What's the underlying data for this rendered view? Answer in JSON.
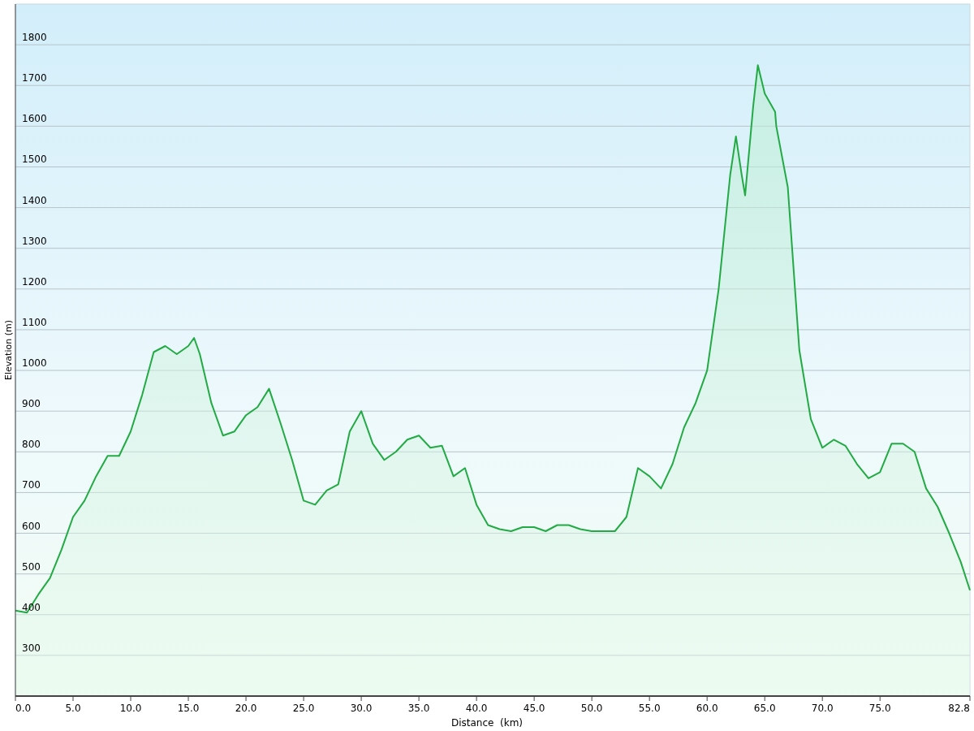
{
  "chart": {
    "chart_data": {
      "type": "area",
      "grid": true,
      "xlabel": "Distance  (km)",
      "ylabel": "Elevation (m)",
      "x": [
        0,
        1,
        2,
        3,
        4,
        5,
        6,
        7,
        8,
        9,
        10,
        11,
        12,
        13,
        14,
        15,
        15.5,
        16,
        17,
        18,
        19,
        20,
        21,
        22,
        23,
        24,
        25,
        26,
        27,
        28,
        29,
        30,
        31,
        32,
        33,
        34,
        35,
        36,
        37,
        38,
        39,
        40,
        41,
        42,
        43,
        44,
        45,
        46,
        47,
        48,
        49,
        50,
        51,
        52,
        53,
        54,
        55,
        56,
        57,
        58,
        59,
        60,
        61,
        62,
        62.5,
        63,
        63.3,
        64,
        64.4,
        65,
        65.9,
        66,
        67,
        68,
        69,
        70,
        71,
        72,
        73,
        74,
        75,
        76,
        77,
        78,
        79,
        80,
        81,
        82,
        82.8
      ],
      "series": [
        {
          "color": "#22aa44",
          "values": [
            410,
            405,
            450,
            490,
            560,
            640,
            680,
            740,
            790,
            790,
            850,
            940,
            1045,
            1060,
            1040,
            1060,
            1080,
            1040,
            920,
            840,
            850,
            890,
            910,
            955,
            870,
            780,
            680,
            670,
            705,
            720,
            850,
            900,
            820,
            780,
            800,
            830,
            840,
            810,
            815,
            740,
            760,
            670,
            620,
            610,
            605,
            615,
            615,
            605,
            620,
            620,
            610,
            605,
            605,
            605,
            640,
            760,
            740,
            710,
            770,
            860,
            920,
            1000,
            1200,
            1480,
            1575,
            1480,
            1430,
            1650,
            1750,
            1680,
            1635,
            1600,
            1450,
            1050,
            880,
            810,
            830,
            815,
            770,
            735,
            750,
            820,
            820,
            800,
            710,
            665,
            600,
            530,
            460
          ]
        }
      ],
      "xlim": [
        0,
        82.8
      ],
      "ylim": [
        200,
        1900
      ],
      "xticks": [
        {
          "value": 0,
          "label": "0.0"
        },
        {
          "value": 5,
          "label": "5.0"
        },
        {
          "value": 10,
          "label": "10.0"
        },
        {
          "value": 15,
          "label": "15.0"
        },
        {
          "value": 20,
          "label": "20.0"
        },
        {
          "value": 25,
          "label": "25.0"
        },
        {
          "value": 30,
          "label": "30.0"
        },
        {
          "value": 35,
          "label": "35.0"
        },
        {
          "value": 40,
          "label": "40.0"
        },
        {
          "value": 45,
          "label": "45.0"
        },
        {
          "value": 50,
          "label": "50.0"
        },
        {
          "value": 55,
          "label": "55.0"
        },
        {
          "value": 60,
          "label": "60.0"
        },
        {
          "value": 65,
          "label": "65.0"
        },
        {
          "value": 70,
          "label": "70.0"
        },
        {
          "value": 75,
          "label": "75.0"
        },
        {
          "value": 82.8,
          "label": "82.8"
        }
      ],
      "yticks": [
        300,
        400,
        500,
        600,
        700,
        800,
        900,
        1000,
        1100,
        1200,
        1300,
        1400,
        1500,
        1600,
        1700,
        1800
      ]
    }
  }
}
